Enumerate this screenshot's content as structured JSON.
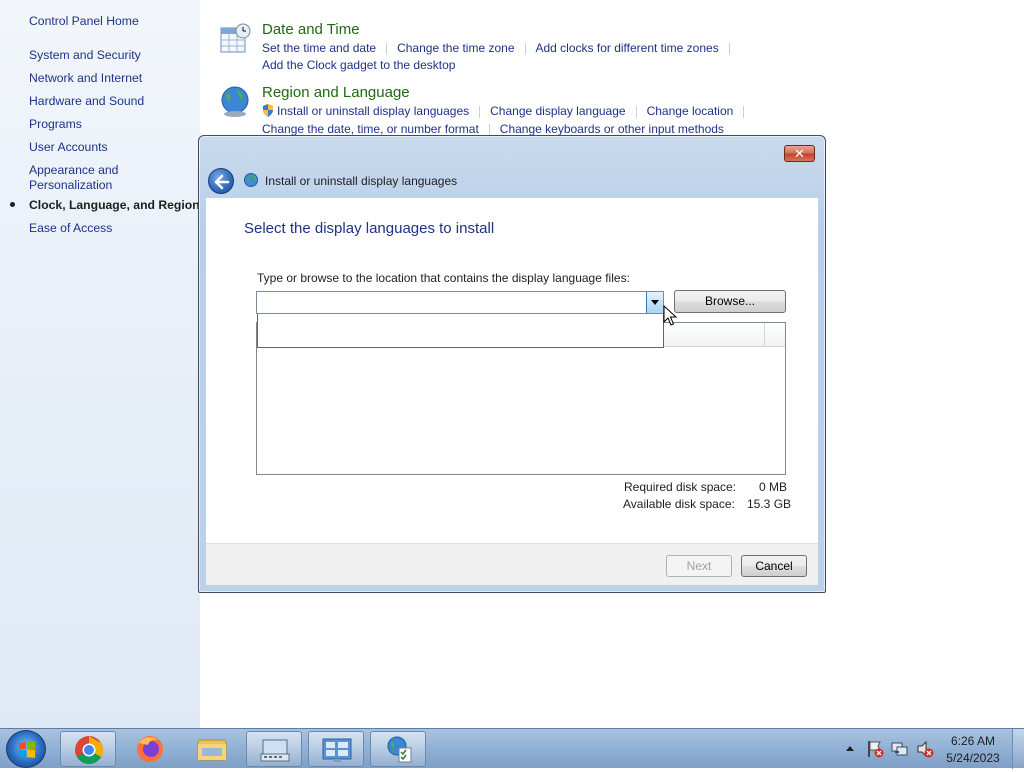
{
  "leftnav": {
    "home": "Control Panel Home",
    "items": [
      {
        "label": "System and Security"
      },
      {
        "label": "Network and Internet"
      },
      {
        "label": "Hardware and Sound"
      },
      {
        "label": "Programs"
      },
      {
        "label": "User Accounts"
      },
      {
        "label": "Appearance and\nPersonalization"
      },
      {
        "label": "Clock, Language, and Region",
        "current": true
      },
      {
        "label": "Ease of Access"
      }
    ]
  },
  "categories": {
    "datetime": {
      "title": "Date and Time",
      "links": [
        "Set the time and date",
        "Change the time zone",
        "Add clocks for different time zones",
        "Add the Clock gadget to the desktop"
      ]
    },
    "region": {
      "title": "Region and Language",
      "links": [
        "Install or uninstall display languages",
        "Change display language",
        "Change location",
        "Change the date, time, or number format",
        "Change keyboards or other input methods"
      ]
    }
  },
  "dialog": {
    "title": "Install or uninstall display languages",
    "heading": "Select the display languages to install",
    "path_label": "Type or browse to the location that contains the display language files:",
    "path_value": "",
    "browse_label": "Browse...",
    "required_label": "Required disk space:",
    "required_value": "0 MB",
    "available_label": "Available disk space:",
    "available_value": "15.3 GB",
    "next_label": "Next",
    "cancel_label": "Cancel",
    "close_glyph": "✕"
  },
  "taskbar": {
    "apps": [
      "chrome-icon",
      "firefox-icon",
      "file-explorer-icon",
      "keyboard-settings-icon",
      "control-panel-icon",
      "region-language-icon"
    ],
    "time": "6:26 AM",
    "date": "5/24/2023"
  },
  "colors": {
    "link": "#1e3287",
    "category_title": "#1e6b12",
    "heading": "#1e3287"
  }
}
